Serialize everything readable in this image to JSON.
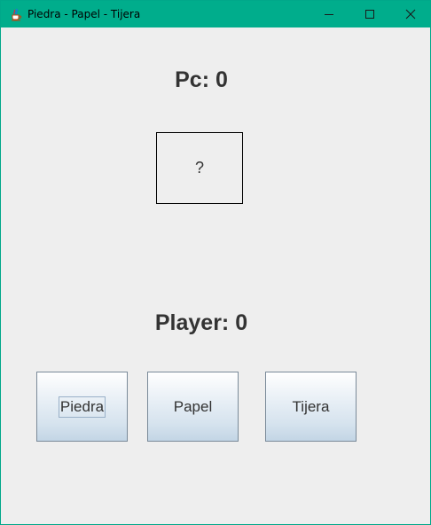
{
  "window": {
    "title": "Piedra - Papel - Tijera",
    "icon": "java-cup-icon",
    "titlebar_color": "#00ad8c",
    "controls": [
      "minimize-icon",
      "maximize-icon",
      "close-icon"
    ]
  },
  "game": {
    "pc_score": "Pc: 0",
    "pc_choice": "?",
    "player_score": "Player: 0",
    "buttons": [
      {
        "label": "Piedra",
        "focused": true
      },
      {
        "label": "Papel",
        "focused": false
      },
      {
        "label": "Tijera",
        "focused": false
      }
    ]
  }
}
